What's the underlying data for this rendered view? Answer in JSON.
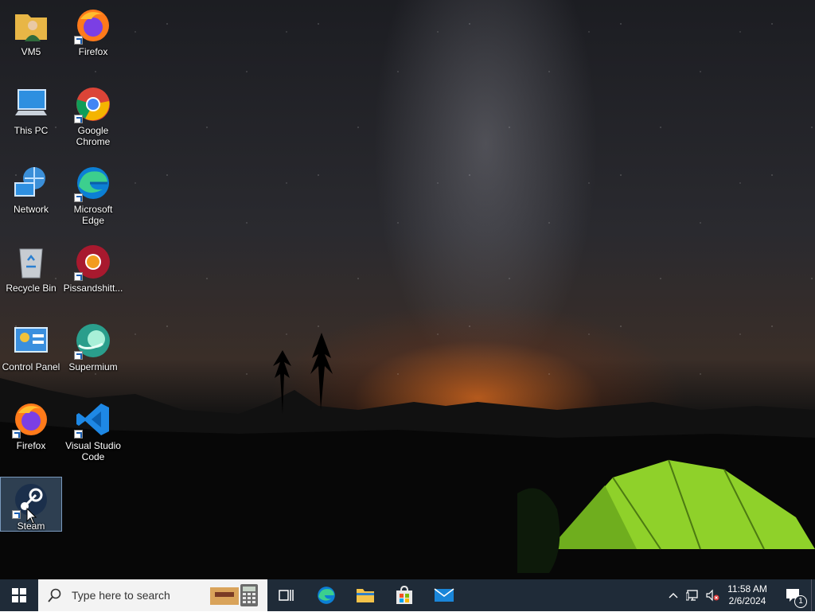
{
  "desktop_icons": [
    {
      "label": "VM5"
    },
    {
      "label": "Firefox"
    },
    {
      "label": "This PC"
    },
    {
      "label": "Google Chrome"
    },
    {
      "label": "Network"
    },
    {
      "label": "Microsoft Edge"
    },
    {
      "label": "Recycle Bin"
    },
    {
      "label": "Pissandshitt..."
    },
    {
      "label": "Control Panel"
    },
    {
      "label": "Supermium"
    },
    {
      "label": "Firefox"
    },
    {
      "label": "Visual Studio Code"
    },
    {
      "label": "Steam"
    }
  ],
  "taskbar": {
    "search_placeholder": "Type here to search",
    "pinned": [
      "task-view",
      "edge",
      "file-explorer",
      "microsoft-store",
      "mail"
    ],
    "clock": {
      "time": "11:58 AM",
      "date": "2/6/2024"
    },
    "notification_count": "1",
    "accent": "#1f2b38"
  }
}
